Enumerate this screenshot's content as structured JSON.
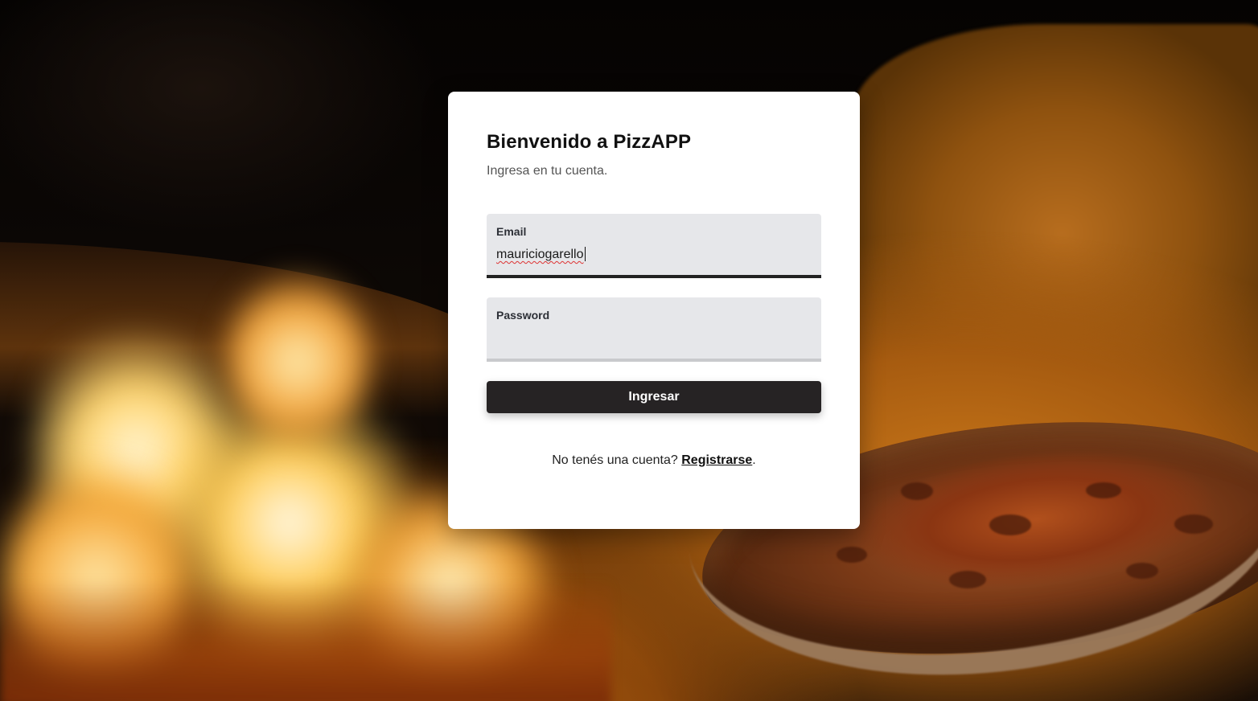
{
  "login": {
    "title": "Bienvenido a PizzAPP",
    "subtitle": "Ingresa en tu cuenta.",
    "email_label": "Email",
    "email_value": "mauriciogarello",
    "password_label": "Password",
    "password_value": "",
    "submit_label": "Ingresar",
    "register_prompt": "No tenés una cuenta? ",
    "register_link": "Registrarse",
    "register_suffix": "."
  },
  "colors": {
    "card_background": "#ffffff",
    "input_background": "#e6e7ea",
    "button_background": "#262324",
    "button_text": "#ffffff",
    "active_input_border": "#222222"
  }
}
